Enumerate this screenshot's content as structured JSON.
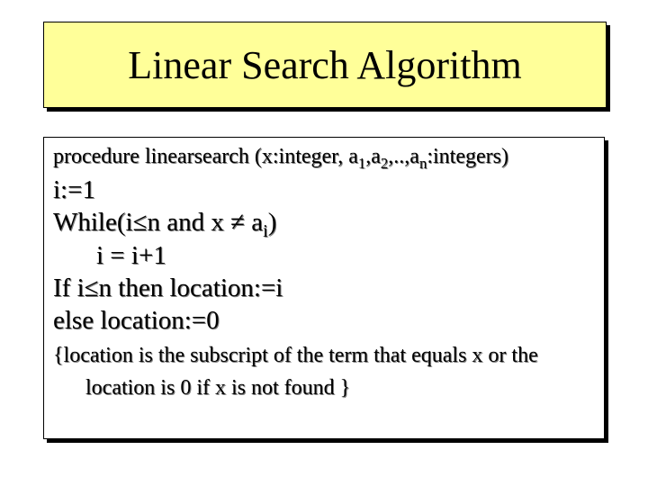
{
  "title": "Linear Search Algorithm",
  "proc": {
    "pre": "procedure linearsearch (x:integer, a",
    "sub1": "1",
    "mid1": ",a",
    "sub2": "2",
    "mid2": ",..,a",
    "sub3": "n",
    "post": ":integers)"
  },
  "lines": {
    "l1": "i:=1",
    "l2_pre": "While(i≤n and x ≠ a",
    "l2_sub": "i",
    "l2_post": ")",
    "l3": "i = i+1",
    "l4": "If i≤n then location:=i",
    "l5": "else location:=0"
  },
  "footnote": {
    "a": "{location is the subscript of the term that equals x or the",
    "b": "location is 0 if x is not found }"
  }
}
